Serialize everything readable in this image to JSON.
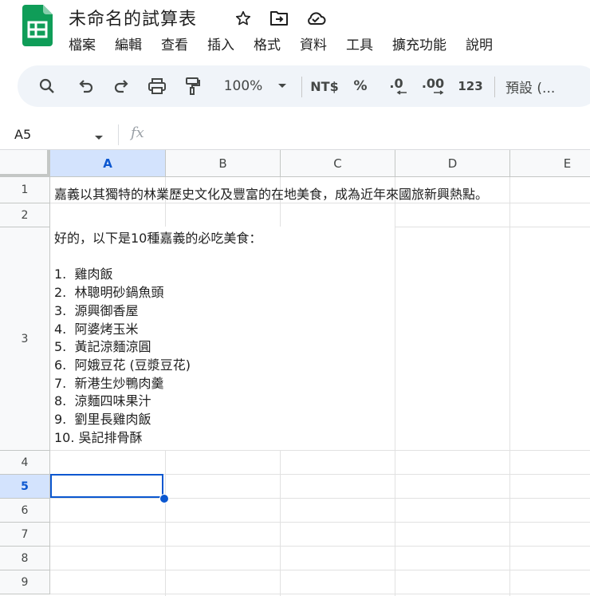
{
  "app": {
    "title": "未命名的試算表",
    "brand_color": "#0f9d58",
    "accent_color": "#0b57d0"
  },
  "menu": [
    "檔案",
    "編輯",
    "查看",
    "插入",
    "格式",
    "資料",
    "工具",
    "擴充功能",
    "說明"
  ],
  "toolbar": {
    "icons": [
      "search-icon",
      "undo-icon",
      "redo-icon",
      "print-icon",
      "paint-format-icon"
    ],
    "zoom": "100%",
    "currency": "NT$",
    "percent": "%",
    "decrease_decimal": ".0",
    "increase_decimal": ".00",
    "number_format": "123",
    "font_default": "預設 (..."
  },
  "formula_bar": {
    "name_box": "A5",
    "fx": "fx",
    "content": ""
  },
  "sheet": {
    "columns": [
      "A",
      "B",
      "C",
      "D",
      "E"
    ],
    "rows": [
      "1",
      "2",
      "3",
      "4",
      "5",
      "6",
      "7",
      "8",
      "9"
    ],
    "selected_cell": "A5",
    "cells": {
      "A1": "嘉義以其獨特的林業歷史文化及豐富的在地美食，成為近年來國旅新興熱點。",
      "A3": "好的，以下是10種嘉義的必吃美食：\n\n1.  雞肉飯\n2.  林聰明砂鍋魚頭\n3.  源興御香屋\n4.  阿婆烤玉米\n5.  黃記涼麵涼圓\n6.  阿娥豆花 (豆漿豆花)\n7.  新港生炒鴨肉羹\n8.  涼麵四味果汁\n9.  劉里長雞肉飯\n10. 吳記排骨酥"
    }
  }
}
